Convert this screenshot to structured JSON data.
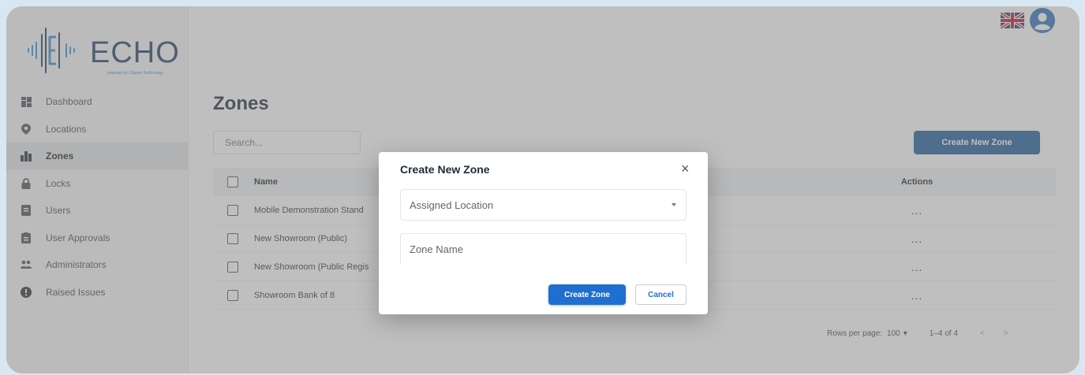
{
  "brand": {
    "name": "ECHO",
    "tagline": "powered by Clayton Technology"
  },
  "sidebar": {
    "items": [
      {
        "label": "Dashboard",
        "icon": "dashboard-icon"
      },
      {
        "label": "Locations",
        "icon": "location-pin-icon"
      },
      {
        "label": "Zones",
        "icon": "buildings-icon",
        "active": true
      },
      {
        "label": "Locks",
        "icon": "lock-icon"
      },
      {
        "label": "Users",
        "icon": "id-card-icon"
      },
      {
        "label": "User Approvals",
        "icon": "clipboard-icon"
      },
      {
        "label": "Administrators",
        "icon": "people-icon"
      },
      {
        "label": "Raised Issues",
        "icon": "alert-icon"
      }
    ]
  },
  "header": {
    "flag": "uk-flag-icon",
    "avatar": "user-avatar-icon"
  },
  "main": {
    "title": "Zones",
    "search_placeholder": "Search...",
    "create_button": "Create New Zone",
    "table": {
      "columns": [
        "Name",
        "Actions"
      ],
      "rows": [
        {
          "name": "Mobile Demonstration Stand",
          "actions": "..."
        },
        {
          "name": "New Showroom (Public)",
          "actions": "..."
        },
        {
          "name": "New Showroom (Public Regis",
          "actions": "..."
        },
        {
          "name": "Showroom Bank of 8",
          "actions": "..."
        }
      ]
    },
    "pagination": {
      "rows_label": "Rows per page:",
      "rows_value": "100",
      "range": "1–4 of 4",
      "prev": "<",
      "next": ">"
    }
  },
  "modal": {
    "title": "Create New Zone",
    "close": "×",
    "location_placeholder": "Assigned Location",
    "zone_name_placeholder": "Zone Name",
    "submit": "Create Zone",
    "cancel": "Cancel"
  },
  "colors": {
    "brand_dark": "#1e3d63",
    "brand_light": "#3a8fc9",
    "primary": "#1f6fd0",
    "header_button": "#1f5b9a"
  }
}
